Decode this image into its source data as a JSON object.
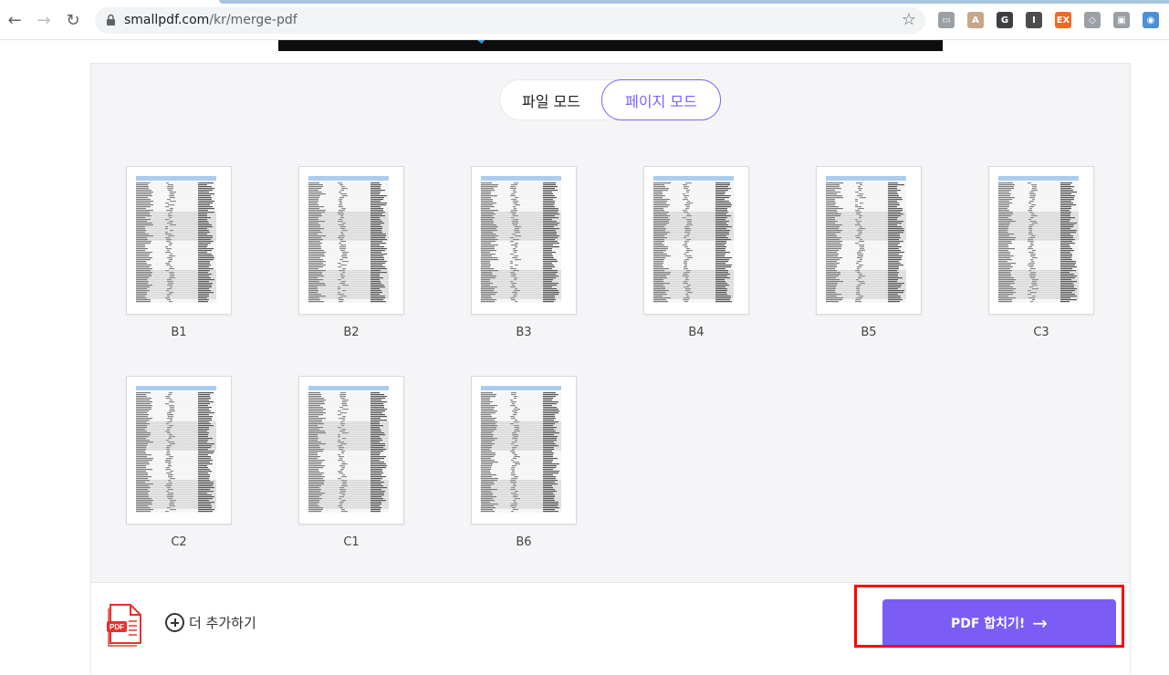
{
  "browser": {
    "url_host": "smallpdf.com",
    "url_path": "/kr/merge-pdf",
    "back_icon": "←",
    "forward_icon": "→",
    "reload_icon": "↻",
    "star_icon": "☆",
    "extensions": [
      {
        "name": "ext-slides",
        "glyph": "▭",
        "color": "#9aa0a6"
      },
      {
        "name": "ext-acrobat",
        "glyph": "A",
        "color": "#c8a68a"
      },
      {
        "name": "ext-grammarly",
        "glyph": "G",
        "color": "#3c4043"
      },
      {
        "name": "ext-info",
        "glyph": "I",
        "color": "#4d4d4d"
      },
      {
        "name": "ext-ex",
        "glyph": "EX",
        "color": "#f26722"
      },
      {
        "name": "ext-shield",
        "glyph": "◇",
        "color": "#9aa0a6"
      },
      {
        "name": "ext-cast",
        "glyph": "▣",
        "color": "#9aa0a6"
      },
      {
        "name": "ext-owl",
        "glyph": "◉",
        "color": "#4a90d9"
      }
    ]
  },
  "mode_toggle": {
    "file_mode": "파일 모드",
    "page_mode": "페이지 모드",
    "active": "page_mode"
  },
  "pages": [
    {
      "label": "B1"
    },
    {
      "label": "B2"
    },
    {
      "label": "B3"
    },
    {
      "label": "B4"
    },
    {
      "label": "B5"
    },
    {
      "label": "C3"
    },
    {
      "label": "C2"
    },
    {
      "label": "C1"
    },
    {
      "label": "B6"
    }
  ],
  "footer": {
    "add_more": "더 추가하기",
    "merge_button": "PDF 합치기!",
    "merge_arrow": "→",
    "pdf_icon_text": "PDF"
  },
  "colors": {
    "accent": "#7b5cf5",
    "highlight": "#ff0000",
    "pdf_red": "#e5322d"
  }
}
